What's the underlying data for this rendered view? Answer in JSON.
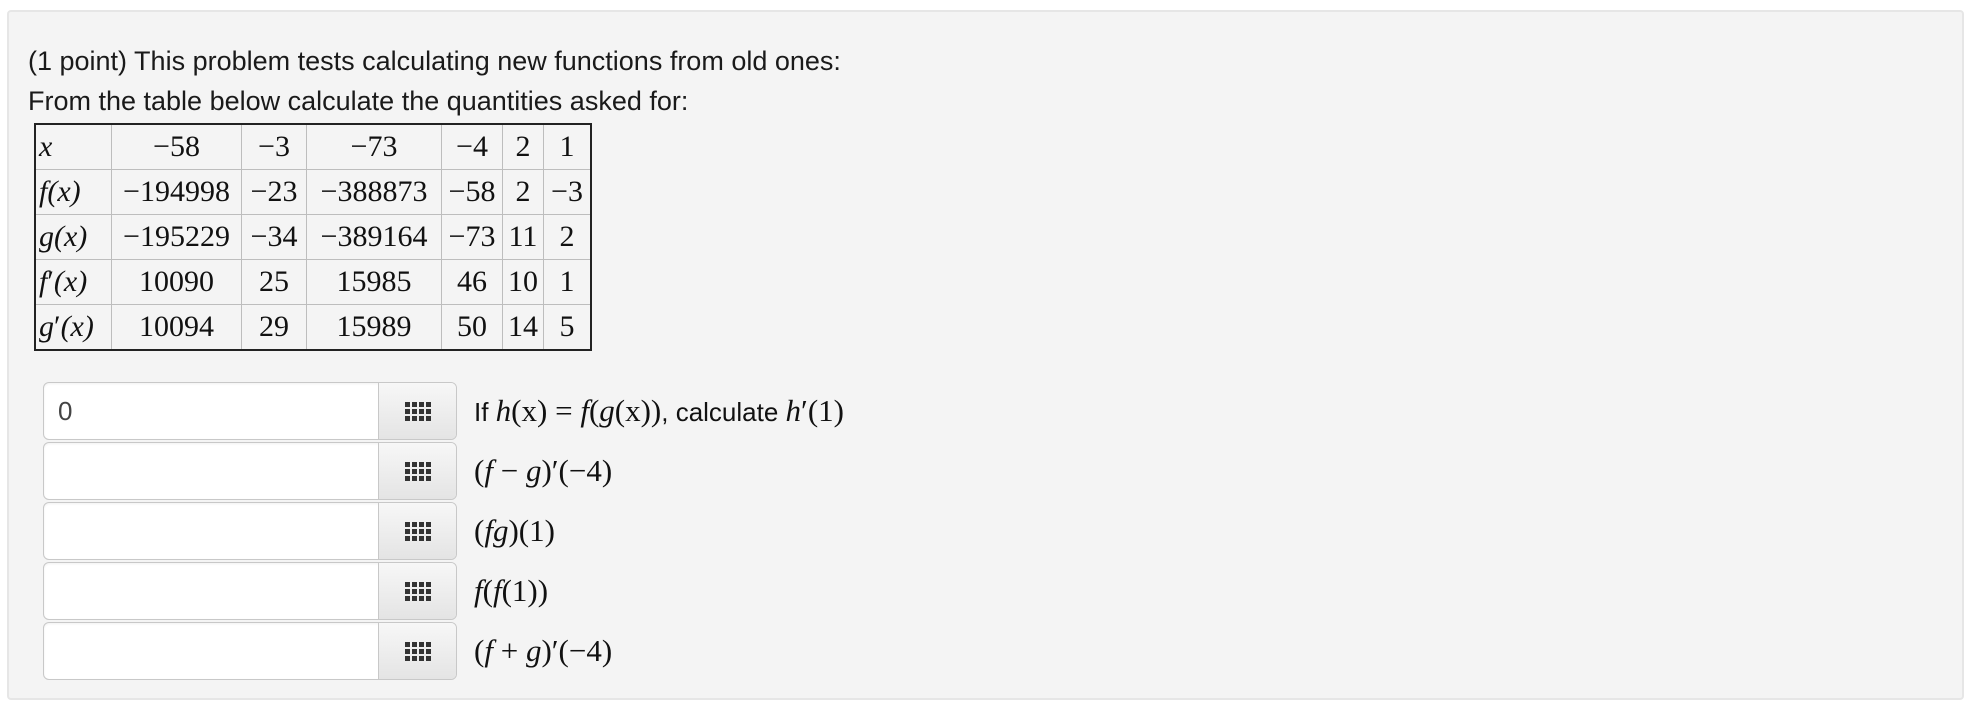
{
  "problem": {
    "intro_line1": "(1 point) This problem tests calculating new functions from old ones:",
    "intro_line2": "From the table below calculate the quantities asked for:"
  },
  "table": {
    "header": [
      "x",
      "−58",
      "−3",
      "−73",
      "−4",
      "2",
      "1"
    ],
    "rows": [
      {
        "label": {
          "f": "f",
          "prime": "",
          "var": "(x)"
        },
        "cells": [
          "−194998",
          "−23",
          "−388873",
          "−58",
          "2",
          "−3"
        ]
      },
      {
        "label": {
          "f": "g",
          "prime": "",
          "var": "(x)"
        },
        "cells": [
          "−195229",
          "−34",
          "−389164",
          "−73",
          "11",
          "2"
        ]
      },
      {
        "label": {
          "f": "f",
          "prime": "′",
          "var": "(x)"
        },
        "cells": [
          "10090",
          "25",
          "15985",
          "46",
          "10",
          "1"
        ]
      },
      {
        "label": {
          "f": "g",
          "prime": "′",
          "var": "(x)"
        },
        "cells": [
          "10094",
          "29",
          "15989",
          "50",
          "14",
          "5"
        ]
      }
    ]
  },
  "questions": [
    {
      "value": "0",
      "prefix": "If ",
      "def_h": "h",
      "def_x1": "(x) = ",
      "def_f": "f",
      "def_open": "(",
      "def_g": "g",
      "def_x2": "(x)",
      "def_close": ")",
      "middle": ", calculate ",
      "ask_h": "h",
      "ask_rest": "′(1)"
    },
    {
      "value": "",
      "parts": [
        "(",
        "f",
        " − ",
        "g",
        ")′(−4)"
      ]
    },
    {
      "value": "",
      "parts": [
        "(",
        "fg",
        ")(1)",
        "",
        ""
      ]
    },
    {
      "value": "",
      "parts": [
        "",
        "f",
        "(",
        "f",
        "(1))"
      ]
    },
    {
      "value": "",
      "parts": [
        "(",
        "f",
        " + ",
        "g",
        ")′(−4)"
      ]
    }
  ],
  "icons": {
    "palette": "equation-palette-grid-icon"
  }
}
